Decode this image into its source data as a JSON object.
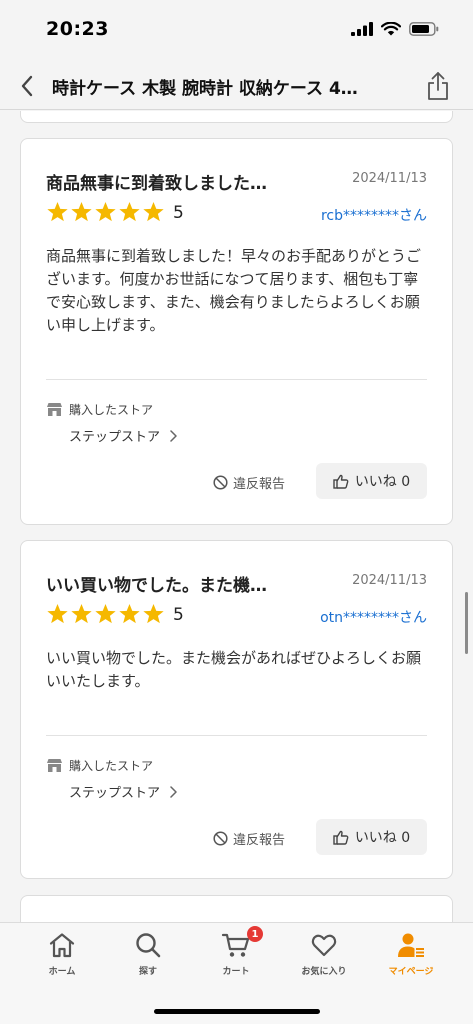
{
  "status": {
    "time": "20:23"
  },
  "nav": {
    "title": "時計ケース 木製 腕時計 収納ケース 4…"
  },
  "colors": {
    "star": "#f5b800",
    "accent": "#f08c00",
    "link": "#1a6fd1",
    "badge": "#e53935"
  },
  "reviews": [
    {
      "title": "商品無事に到着致しました…",
      "date": "2024/11/13",
      "rating": 5,
      "score_label": "5",
      "user": "rcb********さん",
      "body": "商品無事に到着致しました！早々のお手配ありがとうございます。何度かお世話になつて居ります、梱包も丁寧で安心致します、また、機会有りましたらよろしくお願い申し上げます。",
      "store_heading": "購入したストア",
      "store_name": "ステップストア",
      "report_label": "違反報告",
      "like_label": "いいね 0"
    },
    {
      "title": "いい買い物でした。また機…",
      "date": "2024/11/13",
      "rating": 5,
      "score_label": "5",
      "user": "otn********さん",
      "body": "いい買い物でした。また機会があればぜひよろしくお願いいたします。",
      "store_heading": "購入したストア",
      "store_name": "ステップストア",
      "report_label": "違反報告",
      "like_label": "いいね 0"
    }
  ],
  "tabs": [
    {
      "label": "ホーム",
      "icon": "home-icon"
    },
    {
      "label": "探す",
      "icon": "search-icon"
    },
    {
      "label": "カート",
      "icon": "cart-icon",
      "badge": "1"
    },
    {
      "label": "お気に入り",
      "icon": "heart-icon"
    },
    {
      "label": "マイページ",
      "icon": "user-icon",
      "active": true
    }
  ]
}
